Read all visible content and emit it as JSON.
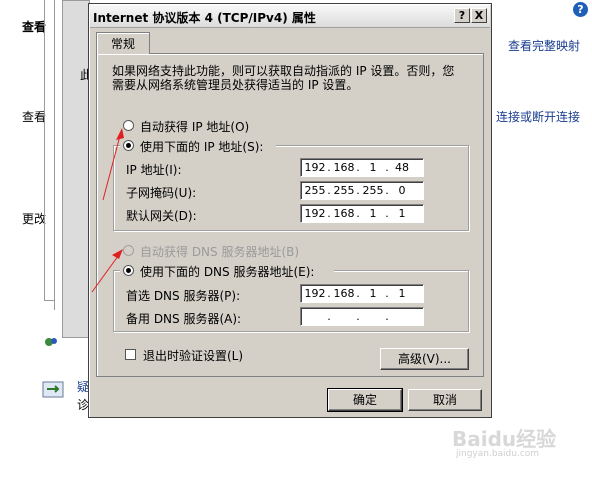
{
  "background": {
    "left_items": [
      "查看",
      "查看",
      "更改"
    ],
    "right_links": [
      "查看完整映射",
      "连接或断开连接"
    ],
    "bottom_item_lines": [
      "疑",
      "诊"
    ],
    "partial_text_left": "此"
  },
  "dialog": {
    "title": "Internet 协议版本 4 (TCP/IPv4) 属性",
    "help_button": "?",
    "close_button": "X",
    "tab_label": "常规",
    "description": "如果网络支持此功能，则可以获取自动指派的 IP 设置。否则，您需要从网络系统管理员处获得适当的 IP 设置。",
    "ip_section": {
      "auto_radio_label": "自动获得 IP 地址(O)",
      "manual_radio_label": "使用下面的 IP 地址(S):",
      "selected": "manual",
      "fields": [
        {
          "label": "IP 地址(I):",
          "octets": [
            "192",
            "168",
            "1",
            "48"
          ]
        },
        {
          "label": "子网掩码(U):",
          "octets": [
            "255",
            "255",
            "255",
            "0"
          ]
        },
        {
          "label": "默认网关(D):",
          "octets": [
            "192",
            "168",
            "1",
            "1"
          ]
        }
      ]
    },
    "dns_section": {
      "auto_radio_label": "自动获得 DNS 服务器地址(B)",
      "auto_disabled": true,
      "manual_radio_label": "使用下面的 DNS 服务器地址(E):",
      "selected": "manual",
      "fields": [
        {
          "label": "首选 DNS 服务器(P):",
          "octets": [
            "192",
            "168",
            "1",
            "1"
          ]
        },
        {
          "label": "备用 DNS 服务器(A):",
          "octets": [
            "",
            "",
            "",
            ""
          ]
        }
      ]
    },
    "validate_checkbox_label": "退出时验证设置(L)",
    "validate_checked": false,
    "advanced_button": "高级(V)...",
    "ok_button": "确定",
    "cancel_button": "取消"
  },
  "watermark": {
    "main": "Baidu经验",
    "sub": "jingyan.baidu.com"
  },
  "colors": {
    "dialog_face": "#d4d0c8",
    "link": "#1a3d8f",
    "annotation_arrow": "#e02020"
  }
}
